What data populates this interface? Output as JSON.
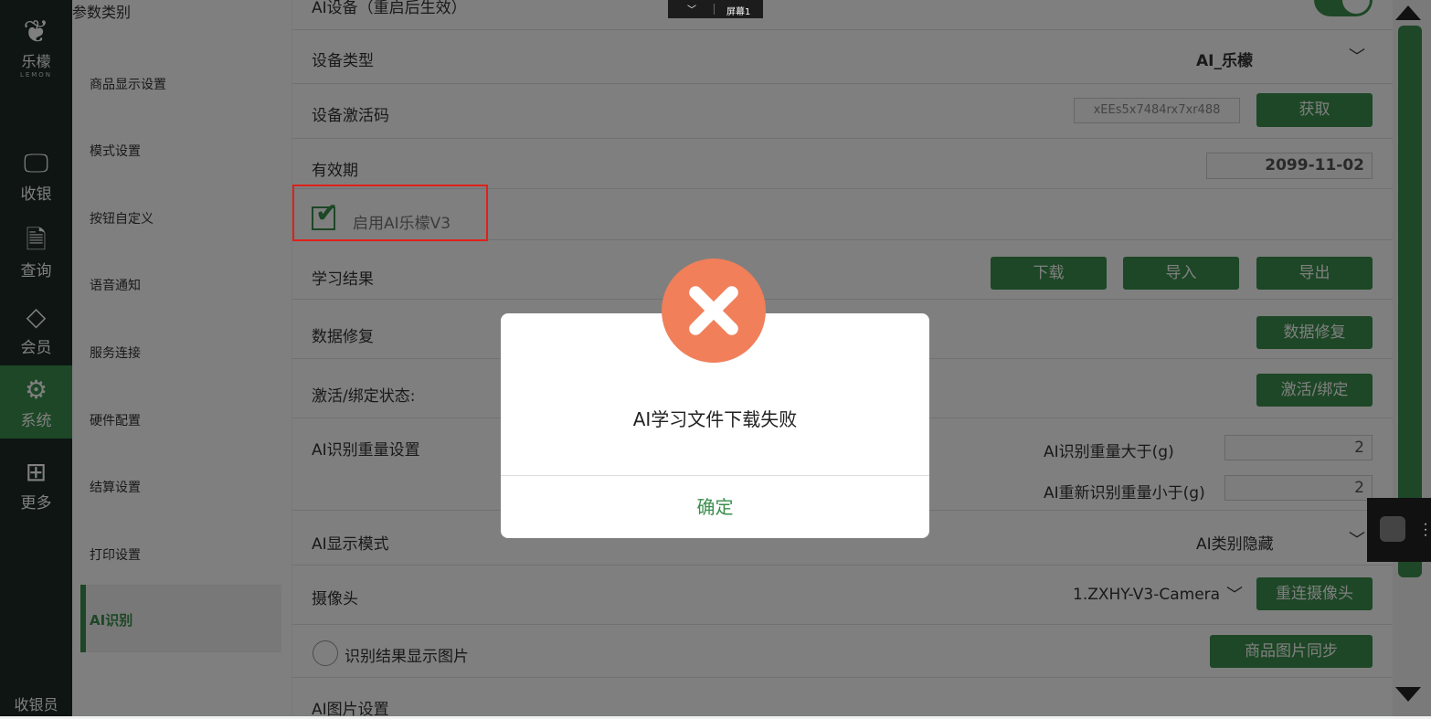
{
  "nav": {
    "brand": "乐檬",
    "brand_en": "LEMON",
    "items": [
      {
        "label": "收银",
        "icon": "monitor-yen-icon"
      },
      {
        "label": "查询",
        "icon": "search-doc-icon"
      },
      {
        "label": "会员",
        "icon": "diamond-icon"
      },
      {
        "label": "系统",
        "icon": "gear-icon"
      },
      {
        "label": "更多",
        "icon": "grid-icon"
      }
    ],
    "active": "系统",
    "cashier": "收银员"
  },
  "categories": {
    "header": "参数类别",
    "items": [
      "商品显示设置",
      "模式设置",
      "按钮自定义",
      "语音通知",
      "服务连接",
      "硬件配置",
      "结算设置",
      "打印设置",
      "AI识别"
    ],
    "active": "AI识别"
  },
  "screen_tab": {
    "label": "屏幕1"
  },
  "settings": {
    "top_partial": "AI设备（重启后生效）",
    "device_type": {
      "label": "设备类型",
      "value": "AI_乐檬"
    },
    "activation_code": {
      "label": "设备激活码",
      "value": "xEEs5x7484rx7xr488",
      "button": "获取"
    },
    "validity": {
      "label": "有效期",
      "value": "2099-11-02"
    },
    "enable_v3": {
      "label": "启用AI乐檬V3",
      "checked": true
    },
    "learning_result": {
      "label": "学习结果",
      "buttons": [
        "下载",
        "导入",
        "导出"
      ]
    },
    "data_repair": {
      "label": "数据修复",
      "button": "数据修复"
    },
    "bind_status": {
      "label": "激活/绑定状态:",
      "button": "激活/绑定"
    },
    "weight": {
      "label": "AI识别重量设置",
      "greater_label": "AI识别重量大于(g)",
      "greater_value": "2",
      "reidentify_label": "AI重新识别重量小于(g)",
      "reidentify_value": "2"
    },
    "display_mode": {
      "label": "AI显示模式",
      "value": "AI类别隐藏"
    },
    "camera": {
      "label": "摄像头",
      "value": "1.ZXHY-V3-Camera",
      "button": "重连摄像头"
    },
    "show_image": {
      "label": "识别结果显示图片",
      "button": "商品图片同步"
    },
    "bottom_partial": "AI图片设置"
  },
  "dialog": {
    "message": "AI学习文件下载失败",
    "ok": "确定",
    "icon": "error-x-icon",
    "icon_color": "#f07f5a"
  },
  "colors": {
    "accent": "#3b8f4c",
    "highlight": "#e0201a"
  }
}
